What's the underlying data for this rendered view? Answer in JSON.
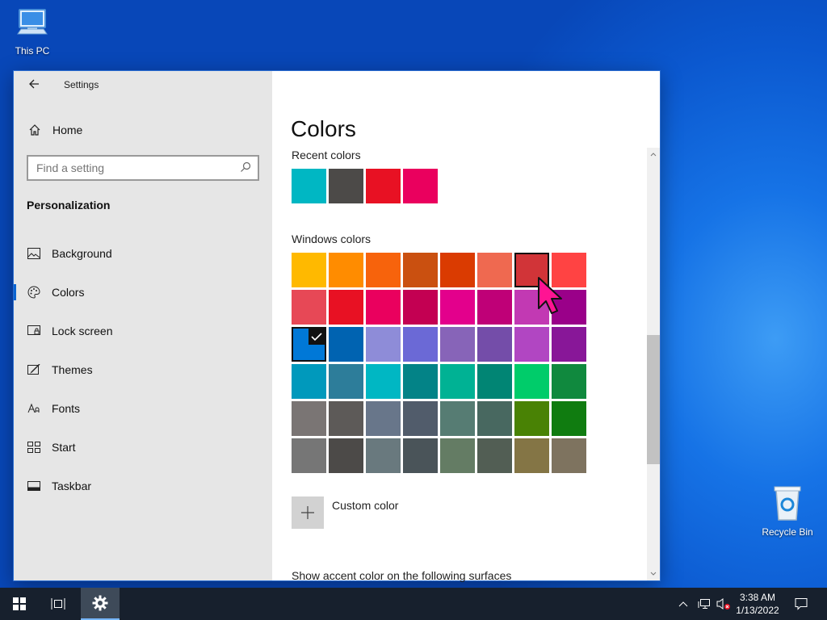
{
  "desktop": {
    "icons": [
      {
        "label": "This PC"
      },
      {
        "label": "Recycle Bin"
      }
    ]
  },
  "window": {
    "title": "Settings",
    "home_label": "Home",
    "search": {
      "placeholder": "Find a setting",
      "value": ""
    },
    "section_title": "Personalization",
    "nav_items": [
      {
        "label": "Background",
        "icon": "picture-icon"
      },
      {
        "label": "Colors",
        "icon": "palette-icon",
        "active": true
      },
      {
        "label": "Lock screen",
        "icon": "lock-screen-icon"
      },
      {
        "label": "Themes",
        "icon": "themes-icon"
      },
      {
        "label": "Fonts",
        "icon": "fonts-icon"
      },
      {
        "label": "Start",
        "icon": "start-icon"
      },
      {
        "label": "Taskbar",
        "icon": "taskbar-icon"
      }
    ]
  },
  "colors_page": {
    "title": "Colors",
    "recent_label": "Recent colors",
    "recent_colors": [
      "#00b7c3",
      "#4c4a48",
      "#e81123",
      "#ea005e"
    ],
    "windows_label": "Windows colors",
    "windows_colors": [
      [
        "#ffb900",
        "#ff8c00",
        "#f7630c",
        "#ca5010",
        "#da3b01",
        "#ef6950",
        "#d13438",
        "#ff4343"
      ],
      [
        "#e74856",
        "#e81123",
        "#ea005e",
        "#c30052",
        "#e3008c",
        "#bf0077",
        "#c239b3",
        "#9a0089"
      ],
      [
        "#0078d7",
        "#0063b1",
        "#8e8cd8",
        "#6b69d6",
        "#8764b8",
        "#744da9",
        "#b146c2",
        "#881798"
      ],
      [
        "#0099bc",
        "#2d7d9a",
        "#00b7c3",
        "#038387",
        "#00b294",
        "#018574",
        "#00cc6a",
        "#10893e"
      ],
      [
        "#7a7574",
        "#5d5a58",
        "#68768a",
        "#515c6b",
        "#567c73",
        "#486860",
        "#498205",
        "#107c10"
      ],
      [
        "#767676",
        "#4c4a48",
        "#69797e",
        "#4a5459",
        "#647c64",
        "#525e54",
        "#847545",
        "#7e735f"
      ]
    ],
    "selected_swatch": {
      "row": 2,
      "col": 0
    },
    "hover_swatch": {
      "row": 0,
      "col": 6
    },
    "custom_color_label": "Custom color",
    "show_accent_label": "Show accent color on the following surfaces"
  },
  "taskbar": {
    "time": "3:38 AM",
    "date": "1/13/2022"
  },
  "colors": {
    "accent": "#0078d7",
    "taskbar_bg": "#17202d",
    "nav_bg": "#e6e6e6",
    "cursor": "#ff1493"
  }
}
